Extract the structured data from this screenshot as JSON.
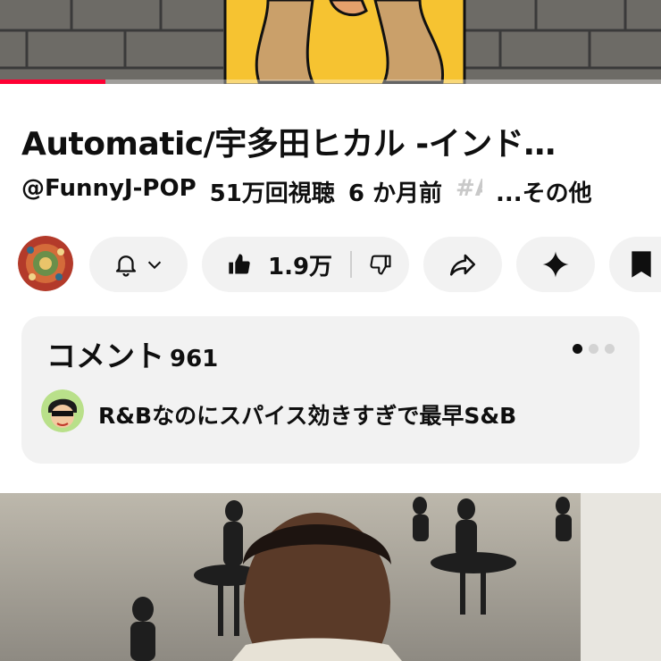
{
  "player": {
    "progress_fraction": 0.16,
    "progress_color": "#ff0033"
  },
  "video": {
    "title": "Automatic/宇多田ヒカル -インド…",
    "channel_handle": "@FunnyJ-POP",
    "views": "51万回視聴",
    "age": "6 か月前",
    "hashtag_fragment": "#A",
    "more_label": "...その他"
  },
  "actions": {
    "subscribe_icon": "bell-icon",
    "like_count": "1.9万",
    "like_icon": "thumbs-up-icon",
    "dislike_icon": "thumbs-down-icon",
    "share_icon": "share-icon",
    "ai_icon": "sparkle-icon",
    "save_icon": "bookmark-icon"
  },
  "comments": {
    "title": "コメント",
    "count": "961",
    "top_comment": "R&Bなのにスパイス効きすぎで最早S&B",
    "page_dots": 3,
    "active_dot": 0
  }
}
